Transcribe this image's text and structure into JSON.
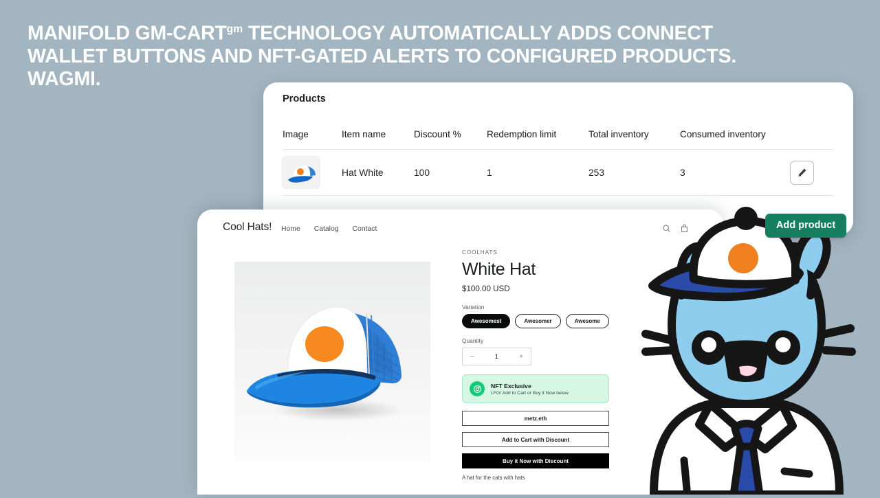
{
  "headline": {
    "line1_a": "MANIFOLD GM-CART",
    "line1_sup": "gm",
    "line1_b": " TECHNOLOGY AUTOMATICALLY ADDS CONNECT WALLET BUTTONS AND NFT-GATED ALERTS TO CONFIGURED PRODUCTS. WAGMI."
  },
  "admin": {
    "card_title": "Products",
    "columns": [
      "Image",
      "Item name",
      "Discount %",
      "Redemption limit",
      "Total inventory",
      "Consumed inventory"
    ],
    "rows": [
      {
        "image_alt": "hat-white-thumbnail",
        "item_name": "Hat White",
        "discount_pct": "100",
        "redemption_limit": "1",
        "total_inventory": "253",
        "consumed_inventory": "3",
        "edit_icon": "pencil-icon"
      }
    ],
    "add_product_label": "Add product",
    "add_product_color": "#157f5f"
  },
  "storefront": {
    "logo": "Cool Hats!",
    "nav": [
      "Home",
      "Catalog",
      "Contact"
    ],
    "icons": [
      "search-icon",
      "shopping-bag-icon"
    ],
    "product": {
      "vendor": "COOLHATS",
      "title": "White Hat",
      "price": "$100.00 USD",
      "variation_label": "Variation",
      "variations": [
        {
          "label": "Awesomest",
          "selected": true
        },
        {
          "label": "Awesomer",
          "selected": false
        },
        {
          "label": "Awesome",
          "selected": false
        }
      ],
      "quantity_label": "Quantity",
      "quantity_minus": "–",
      "quantity_value": "1",
      "quantity_plus": "+",
      "description": "A hat for the cats with hats",
      "image_alt": "white-blue-trucker-hat-photo"
    },
    "nft_alert": {
      "icon": "nft-badge-icon",
      "title": "NFT Exclusive",
      "subtitle": "LFG! Add to Cart or Buy it Now below",
      "bg_color": "#d6f7e4",
      "icon_color": "#14ca7a"
    },
    "buttons": [
      {
        "label": "metz.eth",
        "style": "outline"
      },
      {
        "label": "Add to Cart with Discount",
        "style": "outline"
      },
      {
        "label": "Buy it Now with Discount",
        "style": "dark"
      }
    ]
  },
  "mascot": {
    "alt": "blue-cat-mascot-wearing-hat",
    "body_color": "#8ecdee",
    "hat_dot_color": "#ef7f1f",
    "tie_color": "#2a4aa8"
  },
  "page": {
    "background_color": "#a3b5c0"
  }
}
